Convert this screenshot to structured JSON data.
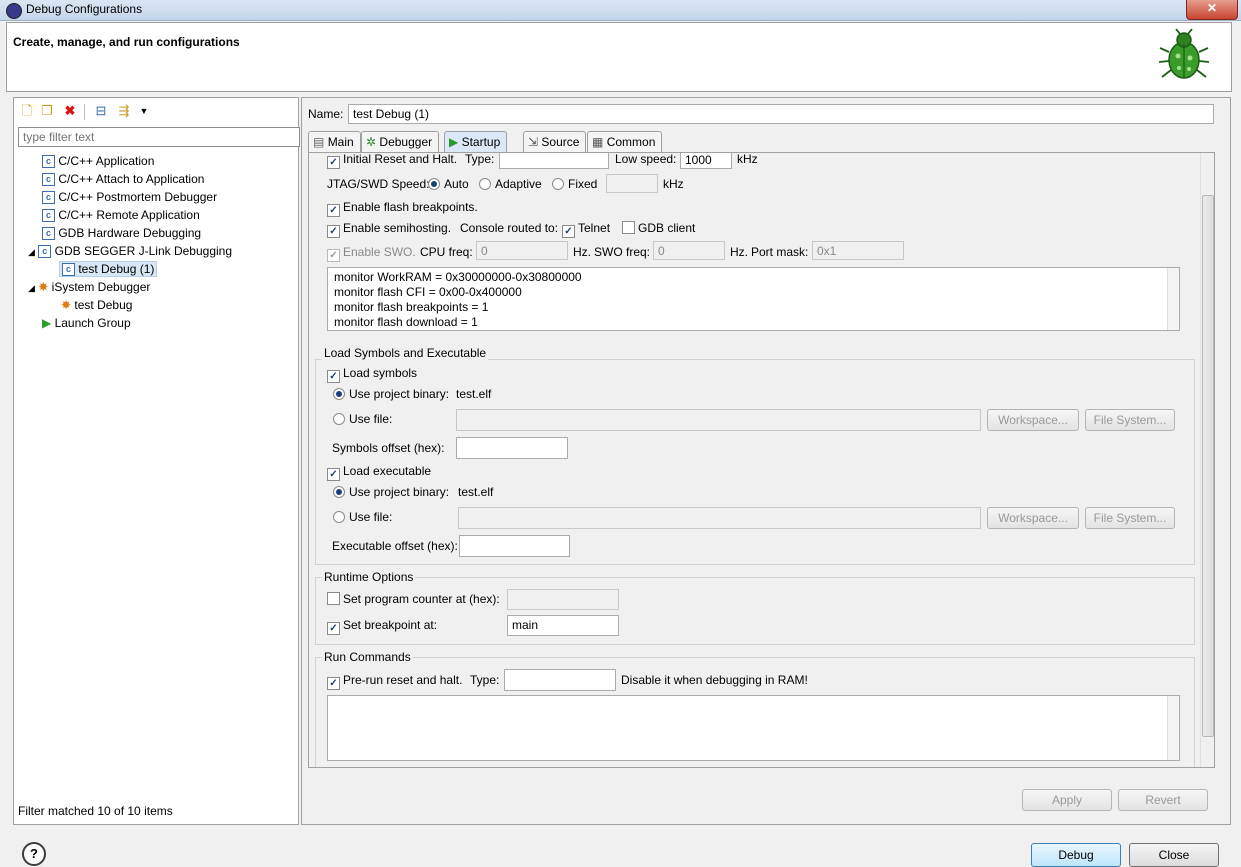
{
  "window": {
    "title": "Debug Configurations",
    "close_glyph": "✕"
  },
  "header": {
    "title": "Create, manage, and run configurations",
    "icon": "bug-icon"
  },
  "left": {
    "toolbar": [
      "new-config-icon",
      "duplicate-icon",
      "delete-icon",
      "collapse-all-icon",
      "filter-icon",
      "menu-dropdown-icon"
    ],
    "filter_placeholder": "type filter text",
    "tree": [
      {
        "label": "C/C++ Application",
        "icon": "c-config-icon"
      },
      {
        "label": "C/C++ Attach to Application",
        "icon": "c-config-icon"
      },
      {
        "label": "C/C++ Postmortem Debugger",
        "icon": "c-config-icon"
      },
      {
        "label": "C/C++ Remote Application",
        "icon": "c-config-icon"
      },
      {
        "label": "GDB Hardware Debugging",
        "icon": "c-config-icon"
      },
      {
        "label": "GDB SEGGER J-Link Debugging",
        "icon": "c-config-icon",
        "expanded": true
      },
      {
        "label": "test Debug (1)",
        "icon": "c-config-icon",
        "selected": true
      },
      {
        "label": "iSystem Debugger",
        "icon": "isystem-icon",
        "expanded": true
      },
      {
        "label": "test Debug",
        "icon": "isystem-icon"
      },
      {
        "label": "Launch Group",
        "icon": "launch-group-icon"
      }
    ],
    "status": "Filter matched 10 of 10 items"
  },
  "right": {
    "name_label": "Name:",
    "name_value": "test Debug (1)",
    "tabs": [
      {
        "label": "Main",
        "icon": "main-tab-icon"
      },
      {
        "label": "Debugger",
        "icon": "debugger-tab-icon"
      },
      {
        "label": "Startup",
        "icon": "startup-tab-icon",
        "active": true
      },
      {
        "label": "Source",
        "icon": "source-tab-icon"
      },
      {
        "label": "Common",
        "icon": "common-tab-icon"
      }
    ],
    "init": {
      "reset_label": "Initial Reset and Halt.",
      "type_label": "Type:",
      "type_value": "",
      "low_speed_label": "Low speed:",
      "low_speed_value": "1000",
      "khz": "kHz",
      "jtag_label": "JTAG/SWD Speed:",
      "auto": "Auto",
      "adaptive": "Adaptive",
      "fixed": "Fixed",
      "fixed_value": "",
      "khz2": "kHz",
      "flash_bp": "Enable flash breakpoints.",
      "semihosting": "Enable semihosting.",
      "console_label": "Console routed to:",
      "telnet": "Telnet",
      "gdb_client": "GDB client",
      "swo": "Enable SWO.",
      "cpu_freq_label": "CPU freq:",
      "cpu_freq_value": "0",
      "hz1": "Hz.",
      "swo_freq_label": "SWO freq:",
      "swo_freq_value": "0",
      "hz2": "Hz.",
      "port_mask_label": "Port mask:",
      "port_mask_value": "0x1",
      "commands": [
        "monitor WorkRAM = 0x30000000-0x30800000",
        "monitor flash CFI = 0x00-0x400000",
        "monitor flash breakpoints = 1",
        "monitor flash download = 1"
      ]
    },
    "load": {
      "group_title": "Load Symbols and Executable",
      "load_symbols": "Load symbols",
      "use_project_binary": "Use project binary:",
      "symbols_binary": "test.elf",
      "use_file": "Use file:",
      "workspace_btn": "Workspace...",
      "filesystem_btn": "File System...",
      "symbols_offset_label": "Symbols offset (hex):",
      "load_executable": "Load executable",
      "use_project_binary2": "Use project binary:",
      "exec_binary": "test.elf",
      "use_file2": "Use file:",
      "workspace_btn2": "Workspace...",
      "filesystem_btn2": "File System...",
      "exec_offset_label": "Executable offset (hex):"
    },
    "runtime": {
      "group_title": "Runtime Options",
      "set_pc": "Set program counter at (hex):",
      "set_bp": "Set breakpoint at:",
      "bp_value": "main"
    },
    "run": {
      "group_title": "Run Commands",
      "pre_run": "Pre-run reset and halt.",
      "type_label": "Type:",
      "note": "Disable it when debugging in RAM!"
    },
    "apply": "Apply",
    "revert": "Revert"
  },
  "footer": {
    "debug": "Debug",
    "close": "Close",
    "help": "?"
  }
}
